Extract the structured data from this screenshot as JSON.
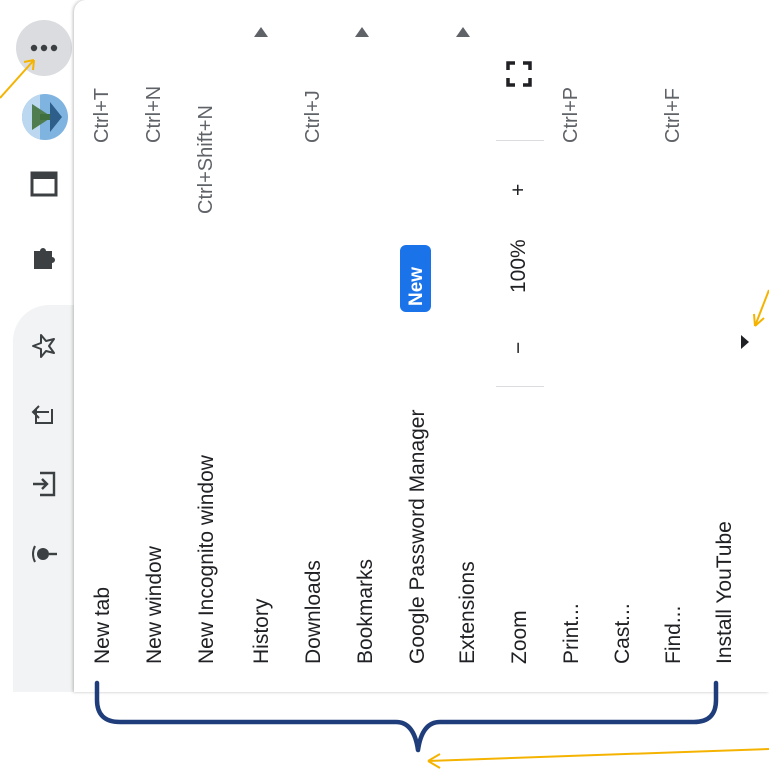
{
  "toolbar": {
    "buttons": [
      "more-menu",
      "profile-avatar",
      "tab-search",
      "extensions",
      "bookmark-star",
      "share",
      "install-app",
      "cast-media"
    ]
  },
  "menu": {
    "items": [
      {
        "label": "New tab",
        "shortcut": "Ctrl+T"
      },
      {
        "label": "New window",
        "shortcut": "Ctrl+N"
      },
      {
        "label": "New Incognito window",
        "shortcut": "Ctrl+Shift+N"
      },
      {
        "label": "History",
        "has_submenu": true
      },
      {
        "label": "Downloads",
        "shortcut": "Ctrl+J"
      },
      {
        "label": "Bookmarks",
        "has_submenu": true
      },
      {
        "label": "Google Password Manager",
        "badge": "New"
      },
      {
        "label": "Extensions",
        "has_submenu": true
      },
      {
        "label": "Zoom",
        "zoom_minus": "−",
        "zoom_value": "100%",
        "zoom_plus": "+"
      },
      {
        "label": "Print...",
        "shortcut": "Ctrl+P"
      },
      {
        "label": "Cast..."
      },
      {
        "label": "Find...",
        "shortcut": "Ctrl+F"
      },
      {
        "label": "Install YouTube"
      }
    ]
  },
  "colors": {
    "accent": "#1a73e8",
    "annotation": "#f5b301",
    "brace": "#1f3d7a"
  }
}
